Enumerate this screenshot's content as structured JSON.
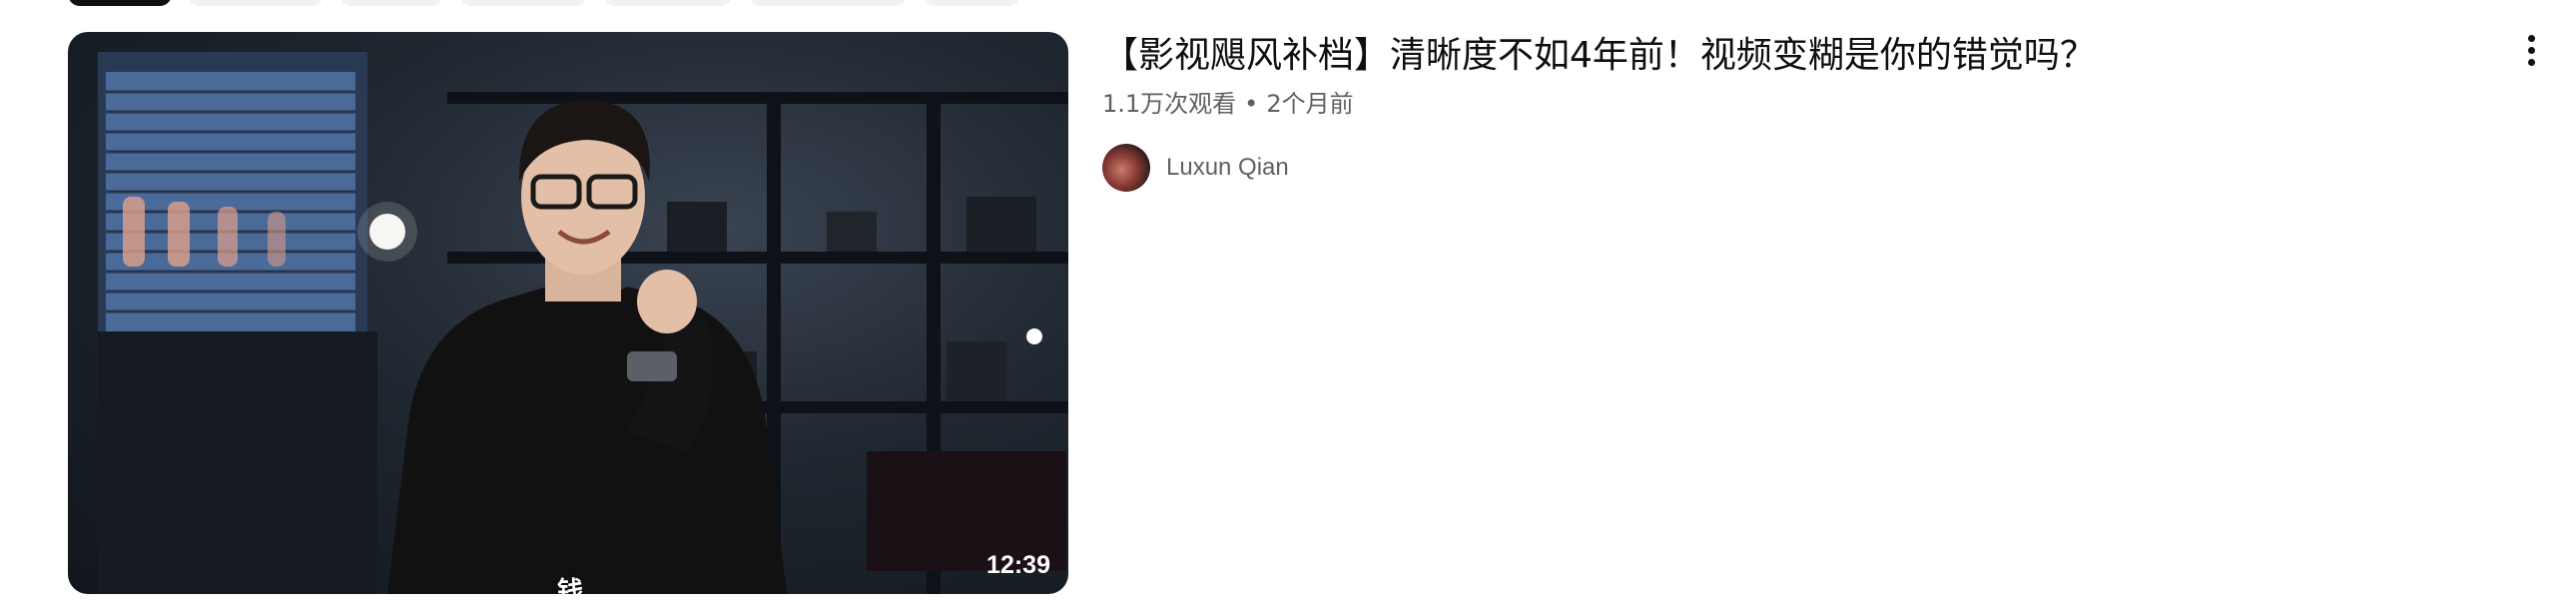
{
  "chips": {
    "count": 7
  },
  "video": {
    "title": "【影视飓风补档】清晰度不如4年前！视频变糊是你的错觉吗？",
    "views": "1.1万次观看",
    "separator": "•",
    "age": "2个月前",
    "duration": "12:39",
    "caption": "钱",
    "channel_name": "Luxun Qian"
  },
  "icons": {
    "menu": "more-vert-icon"
  }
}
